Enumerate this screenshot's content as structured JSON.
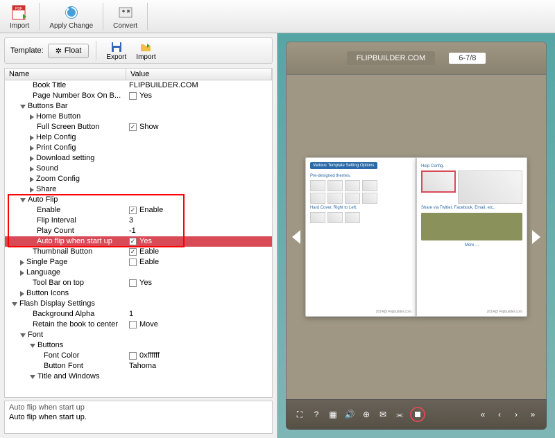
{
  "toolbar": {
    "import_label": "Import",
    "apply_change_label": "Apply Change",
    "convert_label": "Convert"
  },
  "template_bar": {
    "template_label": "Template:",
    "float_label": "Float",
    "export_label": "Export",
    "import_label": "Import"
  },
  "tree_header": {
    "name": "Name",
    "value": "Value"
  },
  "rows": {
    "book_title_name": "Book Title",
    "book_title_value": "FLIPBUILDER.COM",
    "page_number_box_name": "Page Number Box On B...",
    "page_number_box_value": "Yes",
    "buttons_bar": "Buttons Bar",
    "home_button": "Home Button",
    "full_screen_button": "Full Screen Button",
    "full_screen_button_value": "Show",
    "help_config": "Help Config",
    "print_config": "Print Config",
    "download_setting": "Download setting",
    "sound": "Sound",
    "zoom_config": "Zoom Config",
    "share": "Share",
    "auto_flip": "Auto Flip",
    "enable": "Enable",
    "enable_value": "Enable",
    "flip_interval": "Flip Interval",
    "flip_interval_value": "3",
    "play_count": "Play Count",
    "play_count_value": "-1",
    "auto_flip_start": "Auto flip when start up",
    "auto_flip_start_value": "Yes",
    "thumbnail_button": "Thumbnail Button",
    "thumbnail_button_value": "Eable",
    "single_page": "Single Page",
    "single_page_value": "Eable",
    "language": "Language",
    "tool_bar_top": "Tool Bar on top",
    "tool_bar_top_value": "Yes",
    "button_icons": "Button Icons",
    "flash_display": "Flash Display Settings",
    "background_alpha": "Background Alpha",
    "background_alpha_value": "1",
    "retain_center": "Retain the book to center",
    "retain_center_value": "Move",
    "font": "Font",
    "buttons": "Buttons",
    "font_color": "Font Color",
    "font_color_value": "0xffffff",
    "button_font": "Button Font",
    "button_font_value": "Tahoma",
    "title_windows": "Title and Windows"
  },
  "detail": {
    "title": "Auto flip when start up",
    "body": "Auto flip when start up."
  },
  "preview": {
    "title": "FLIPBUILDER.COM",
    "page_indicator": "6-7/8",
    "left_heading": "Various Template Setting Options",
    "left_sub1": "Pre-designed themes.",
    "left_sub2": "Hard Cover, Right to Left.",
    "right_heading": "Help Config.",
    "right_sub": "Share via Twitter, Facebook, Email, etc..",
    "right_more": "More ...",
    "left_foot": "2014@ Flipbuilder.com",
    "right_foot": "2014@ Flipbuilder.com"
  }
}
